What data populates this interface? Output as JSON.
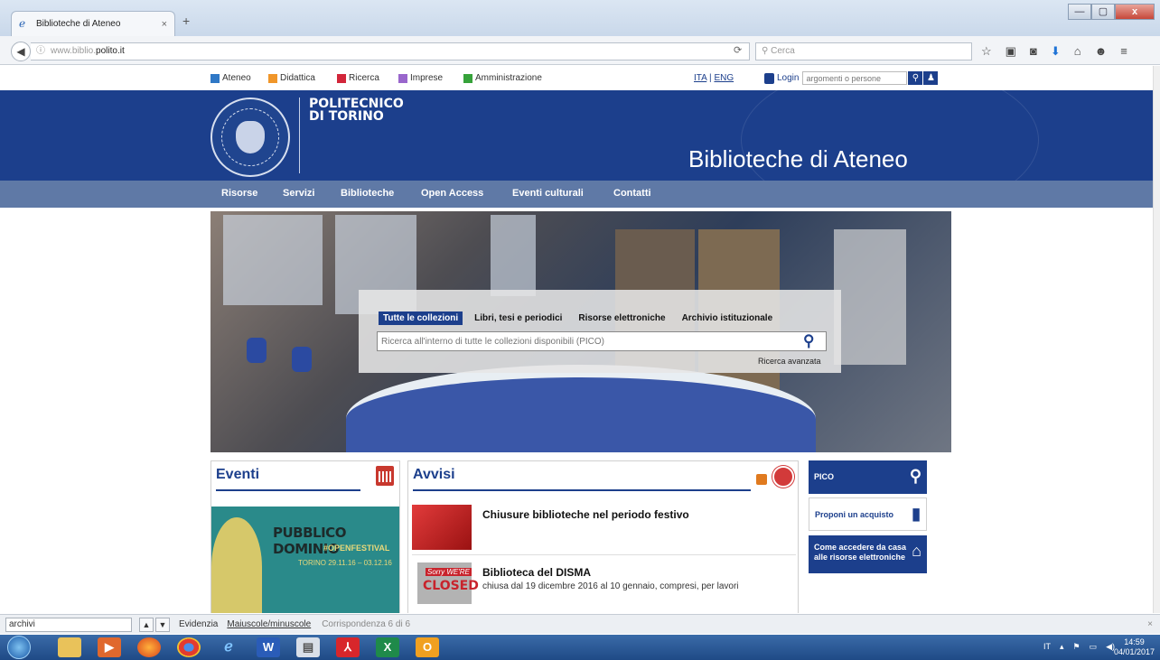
{
  "browser": {
    "tab_title": "Biblioteche di Ateneo",
    "tab_close": "×",
    "new_tab": "+",
    "url_prefix": "www.biblio.",
    "url_domain": "polito.it",
    "search_placeholder": "Cerca",
    "window_buttons": {
      "minimize": "—",
      "maximize": "▢",
      "close": "x"
    }
  },
  "topbar": {
    "categories": [
      {
        "label": "Ateneo",
        "color": "#2f78c6"
      },
      {
        "label": "Didattica",
        "color": "#f0962a"
      },
      {
        "label": "Ricerca",
        "color": "#d2263a"
      },
      {
        "label": "Imprese",
        "color": "#9966cc"
      },
      {
        "label": "Amministrazione",
        "color": "#36a23a"
      }
    ],
    "lang_ita": "ITA",
    "lang_sep": "|",
    "lang_eng": "ENG",
    "login_label": "Login",
    "login_placeholder": "argomenti o persone"
  },
  "header": {
    "logo_line1": "POLITECNICO",
    "logo_line2": "DI TORINO",
    "site_title": "Biblioteche di Ateneo"
  },
  "mainnav": [
    "Risorse",
    "Servizi",
    "Biblioteche",
    "Open Access",
    "Eventi culturali",
    "Contatti"
  ],
  "search": {
    "tabs": [
      "Tutte le collezioni",
      "Libri, tesi e periodici",
      "Risorse elettroniche",
      "Archivio istituzionale"
    ],
    "active_tab": 0,
    "placeholder": "Ricerca all'interno di tutte le collezioni disponibili (PICO)",
    "advanced": "Ricerca avanzata"
  },
  "events": {
    "title": "Eventi",
    "poster_title": "PUBBLICO DOMINIO",
    "poster_tag": "#OPENFESTIVAL",
    "poster_dates": "TORINO   29.11.16 – 03.12.16"
  },
  "avvisi": {
    "title": "Avvisi",
    "items": [
      {
        "title": "Chiusure biblioteche nel periodo festivo",
        "text": ""
      },
      {
        "title": "Biblioteca del DISMA",
        "text": "chiusa dal 19 dicembre 2016 al 10 gennaio, compresi, per lavori",
        "thumb_line1": "Sorry WE'RE",
        "thumb_line2": "CLOSED"
      }
    ]
  },
  "sidebar": [
    {
      "label": "PICO",
      "icon": "search-icon"
    },
    {
      "label": "Proponi un acquisto",
      "icon": "book-icon"
    },
    {
      "label_line1": "Come accedere da casa",
      "label_line2": "alle risorse elettroniche",
      "icon": "house-icon"
    }
  ],
  "findbar": {
    "value": "archivi",
    "highlight": "Evidenzia",
    "match_case": "Maiuscole/minuscole",
    "status": "Corrispondenza 6 di 6"
  },
  "taskbar": {
    "lang": "IT",
    "time": "14:59",
    "date": "04/01/2017"
  }
}
